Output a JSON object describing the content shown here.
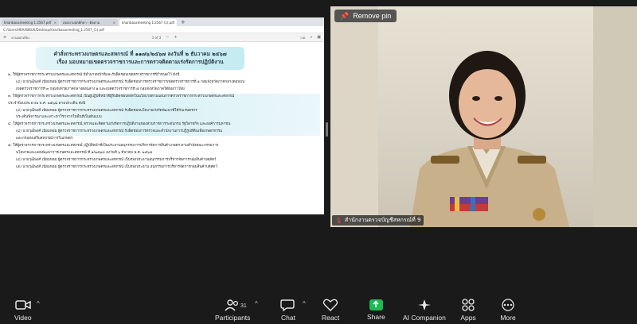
{
  "share": {
    "tabs": [
      {
        "label": "kharibasameeting 1.2567.pdf",
        "active": false
      },
      {
        "label": "สอบถามนักศึกษา - ติดตาม",
        "active": false
      },
      {
        "label": "kharibasameeting 1.2567 (1).pdf",
        "active": true
      }
    ],
    "tab_add": "+",
    "address": "C:/Users/HRAABBUS/Desktop/kharibasameeting_1.2567_(1).pdf",
    "pdfbar": {
      "page_label": "1 of 3",
      "zoom": "อ่านออกเสียง",
      "extra": "วาด"
    },
    "doc": {
      "heading_1": "คำสั่งกระทรวงเกษตรและสหกรณ์ ที่ ๑๑๗๖/๒๕๖๗ ลงวันที่ ๒ ธันวาคม ๒๕๖๗",
      "heading_2": "เรื่อง มอบหมายเขตตรวจราชการและการตรวจติดตามเร่งรัดการปฏิบัติงาน",
      "lines": [
        {
          "text": "๒. ให้ผู้ตรวจราชการกระทรวงเกษตรและสหกรณ์ มีอำนาจหน้าที่และรับผิดชอบเขตตรวจราชการที่กำหนดไว้ ดังนี้",
          "cls": ""
        },
        {
          "text": "(๔) นายวุฒิพงศ์ เนียมหอม ผู้ตรวจราชการกระทรวงเกษตรและสหกรณ์ รับผิดชอบการตรวจราชการเขตตรวจราชการที่ ๑ กลุ่มจังหวัดภาคกลางตอนบน",
          "cls": "sub"
        },
        {
          "text": "เขตตรวจราชการที่ ๓ กลุ่มจังหวัดภาคกลางตอนล่าง ๑ และเขตตรวจราชการที่ ๕ กลุ่มจังหวัดภาคใต้ฝั่งอ่าวไทย",
          "cls": "sub"
        },
        {
          "text": "๓. ให้ผู้ตรวจราชการกระทรวงเกษตรและสหกรณ์ เป็นผู้ปฏิบัติหน้าที่ผู้รับผิดชอบหลักในนโยบายตามแผนการตรวจราชการกระทรวงเกษตรและสหกรณ์",
          "cls": "hl"
        },
        {
          "text": "ประจำปีงบประมาณ พ.ศ. ๒๕๖๘ ตามประเด็น ดังนี้",
          "cls": "hl"
        },
        {
          "text": "(๔) นายวุฒิพงศ์ เนียมหอม ผู้ตรวจราชการกระทรวงเกษตรและสหกรณ์ รับผิดชอบนโยบายเร่งรัดพัฒนาที่ให้กับเกษตรกร",
          "cls": "sub hl"
        },
        {
          "text": "ประเด็นพิจารณาและเสาะหาวิชาจากในพื้นที่เป็นต้นแบบ",
          "cls": "sub hl"
        },
        {
          "text": "๔. ให้ผู้ตรวจราชการกระทรวงเกษตรและสหกรณ์ ตรวจและติดตามเร่งรัดการปฏิบัติงานของส่วนราชการระดับกรม รัฐวิสาหกิจ และองค์การมหาชน",
          "cls": "hl"
        },
        {
          "text": "(๔) นายวุฒิพงศ์ เนียมหอม ผู้ตรวจราชการกระทรวงเกษตรและสหกรณ์ รับผิดชอบการตรวจและสำนักงานการปฏิรูปที่ดินเพื่อเกษตรกรรม",
          "cls": "sub hl"
        },
        {
          "text": "และกรมส่งเสริมสหกรณ์การในเกษตร",
          "cls": "sub"
        },
        {
          "text": "๕. ให้ผู้ตรวจราชการกระทรวงเกษตรและสหกรณ์ ปฏิบัติหน้าที่เป็นประธานอนุกรรมการบริหารจัดการสินค้าเกษตร ตามคำสั่งคณะกรรมการ",
          "cls": ""
        },
        {
          "text": "นโยบายและแผนพัฒนาการเกษตรและสหกรณ์ ที่ ๑/๒๕๖๘ ลงวันที่ ๖ มีนาคม พ.ศ. ๒๕๖๘",
          "cls": "sub"
        },
        {
          "text": "(๔) นายวุฒิพงศ์ เนียมหอม ผู้ตรวจราชการกระทรวงเกษตรและสหกรณ์ เป็นรองประธานอนุกรรมการบริหารจัดการกลุ่มสินค้าปศุสัตว์",
          "cls": "sub"
        },
        {
          "text": "(๕) นายวุฒิพงศ์ เนียมหอม ผู้ตรวจราชการกระทรวงเกษตรและสหกรณ์ เป็นรองประธาน อนุกรรมการบริหารจัดการกลุ่มสินค้าปศุสัตว์",
          "cls": "sub"
        }
      ]
    }
  },
  "video": {
    "pin_label": "Remove pin",
    "participant_name": "สำนักงานตรวจบัญชีสหกรณ์ที่ 9"
  },
  "toolbar": {
    "video": "Video",
    "participants": "Participants",
    "participants_count": "31",
    "chat": "Chat",
    "react": "React",
    "share": "Share",
    "ai": "AI Companion",
    "apps": "Apps",
    "more": "More"
  },
  "colors": {
    "background": "#1a1a1a",
    "share_green": "#1db954",
    "mic_off": "#e04848"
  }
}
